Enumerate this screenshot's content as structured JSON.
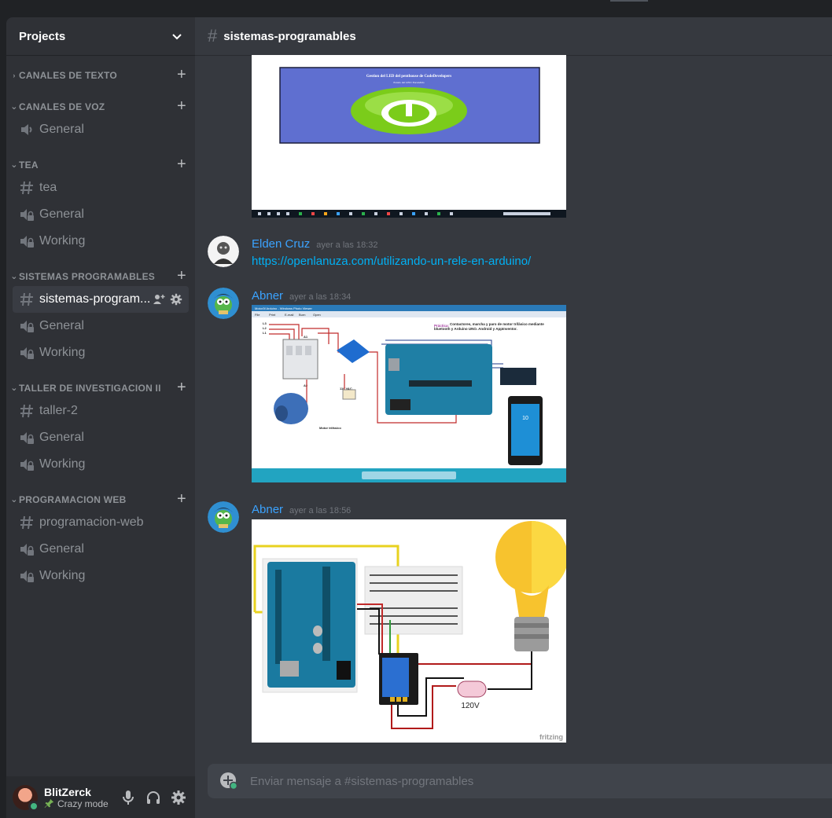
{
  "server": {
    "name": "Projects"
  },
  "categories": [
    {
      "label": "CANALES DE TEXTO",
      "collapsed": true,
      "channels": []
    },
    {
      "label": "CANALES DE VOZ",
      "collapsed": false,
      "channels": [
        {
          "name": "General",
          "type": "voice"
        }
      ]
    },
    {
      "label": "TEA",
      "collapsed": false,
      "channels": [
        {
          "name": "tea",
          "type": "text"
        },
        {
          "name": "General",
          "type": "voice-locked"
        },
        {
          "name": "Working",
          "type": "voice-locked"
        }
      ]
    },
    {
      "label": "SISTEMAS PROGRAMABLES",
      "collapsed": false,
      "channels": [
        {
          "name": "sistemas-program...",
          "type": "text",
          "selected": true
        },
        {
          "name": "General",
          "type": "voice-locked"
        },
        {
          "name": "Working",
          "type": "voice-locked"
        }
      ]
    },
    {
      "label": "TALLER DE INVESTIGACION II",
      "collapsed": false,
      "channels": [
        {
          "name": "taller-2",
          "type": "text"
        },
        {
          "name": "General",
          "type": "voice-locked"
        },
        {
          "name": "Working",
          "type": "voice-locked"
        }
      ]
    },
    {
      "label": "PROGRAMACION WEB",
      "collapsed": false,
      "channels": [
        {
          "name": "programacion-web",
          "type": "text"
        },
        {
          "name": "General",
          "type": "voice-locked"
        },
        {
          "name": "Working",
          "type": "voice-locked"
        }
      ]
    }
  ],
  "user": {
    "name": "BlitZerck",
    "status": "Crazy mode"
  },
  "chat": {
    "channel_name": "sistemas-programables",
    "composer_placeholder": "Enviar mensaje a #sistemas-programables"
  },
  "messages": [
    {
      "author": "Elden Cruz",
      "time": "ayer a las 18:32",
      "link": "https://openlanuza.com/utilizando-un-rele-en-arduino/"
    },
    {
      "author": "Abner",
      "time": "ayer a las 18:34"
    },
    {
      "author": "Abner",
      "time": "ayer a las 18:56"
    }
  ],
  "images": {
    "led_panel": {
      "title": "Gestion del LED del penthouse de CodeDevelopers",
      "subtitle": "Estado del LED: Encendido"
    },
    "motor_diagram": {
      "window_title": "Motor3f Arduino - Windows Photo Viewer",
      "menu": [
        "File",
        "Print",
        "E-mail",
        "Burn",
        "Open"
      ],
      "practice_label": "Práctica:",
      "practice_text": "Contactores, marcha y paro de motor trifásico mediante bluetooth y Arduino UNO. Android y AppInventor.",
      "l1": "L1",
      "l2": "L2",
      "l3": "L3",
      "a1": "A1",
      "a2": "A2",
      "vac": "110 VAC",
      "motor": "Motor trifásico",
      "phone_time": "10"
    },
    "relay_diagram": {
      "voltage": "120V",
      "brand": "fritzing"
    }
  },
  "colors": {
    "accent": "#3ba3ff",
    "link": "#00b0f4",
    "online": "#43b581"
  }
}
